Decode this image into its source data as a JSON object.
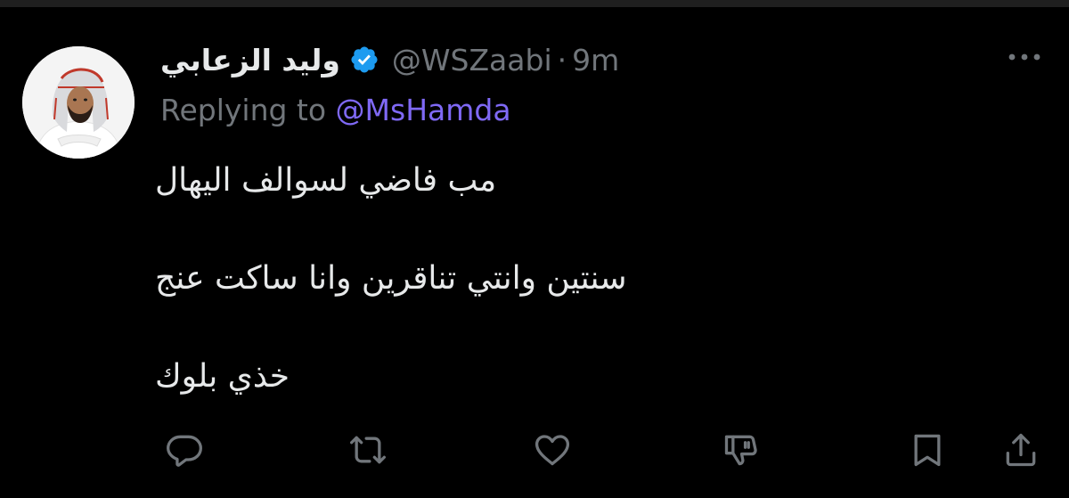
{
  "tweet": {
    "display_name": "وليد الزعابي",
    "handle": "@WSZaabi",
    "separator": "·",
    "timestamp": "9m",
    "reply_prefix": "Replying to ",
    "reply_to": "@MsHamda",
    "lines": [
      "مب فاضي لسوالف اليهال",
      "سنتين وانتي تناقرين وانا ساكت عنج",
      "خذي بلوك"
    ]
  },
  "icons": {
    "verified": "verified-badge-icon",
    "more": "more-options-icon",
    "actions": [
      "reply-icon",
      "retweet-icon",
      "like-icon",
      "downvote-icon",
      "bookmark-icon",
      "share-icon"
    ]
  },
  "colors": {
    "background": "#000000",
    "text_primary": "#e7e9ea",
    "text_secondary": "#71767b",
    "mention": "#7f69f5",
    "verified": "#1d9bf0"
  }
}
